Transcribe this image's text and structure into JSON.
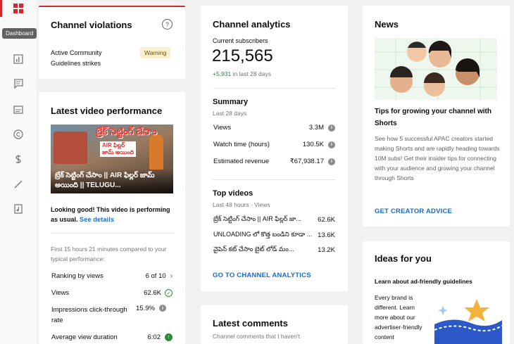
{
  "colors": {
    "accent": "#d0282b",
    "link": "#1a6cc7",
    "positive": "#2e8b3b",
    "warning_bg": "#fcefcf"
  },
  "nav": {
    "tooltip": "Dashboard"
  },
  "violations": {
    "title": "Channel violations",
    "label": "Active Community Guidelines strikes",
    "badge": "Warning"
  },
  "latest_video": {
    "title": "Latest video performance",
    "thumb_overlay_top": "బ్రేక్ సెట్టింగ్ చేసాం",
    "thumb_overlay_mid": "AIR ఫిల్లర్\nజామ్ అయింది",
    "thumb_caption": "బ్రేక్ సెట్టింగ్ చేసాం || AIR ఫిల్లర్ జామ్ అయింది || TELUGU...",
    "status_text": "Looking good! This video is performing as usual.",
    "status_link": "See details",
    "compare_text": "First 15 hours 21 minutes compared to your typical performance:",
    "metrics": [
      {
        "label": "Ranking by views",
        "value": "6 of 10"
      },
      {
        "label": "Views",
        "value": "62.6K"
      },
      {
        "label": "Impressions click-through rate",
        "value": "15.9%"
      },
      {
        "label": "Average view duration",
        "value": "6:02"
      }
    ]
  },
  "analytics": {
    "title": "Channel analytics",
    "subs_label": "Current subscribers",
    "subs_value": "215,565",
    "subs_delta": "+5,931",
    "subs_delta_suffix": " in last 28 days",
    "summary_title": "Summary",
    "summary_period": "Last 28 days",
    "summary": [
      {
        "label": "Views",
        "value": "3.3M"
      },
      {
        "label": "Watch time (hours)",
        "value": "130.5K"
      },
      {
        "label": "Estimated revenue",
        "value": "₹67,938.17"
      }
    ],
    "top_title": "Top videos",
    "top_period": "Last 48 hours · Views",
    "top_videos": [
      {
        "title": "బ్రేక్ సెట్టింగ్ చేసాం || AIR ఫిల్లర్ జా...",
        "views": "62.6K"
      },
      {
        "title": "UNLOADING లో కొత్త బండిని కూడా ...",
        "views": "13.6K"
      },
      {
        "title": "వైపెన్ కట్ చేసాం బైట్ లోడ్ మం...",
        "views": "13.2K"
      }
    ],
    "cta": "GO TO CHANNEL ANALYTICS"
  },
  "comments": {
    "title": "Latest comments",
    "subtitle": "Channel comments that I haven't"
  },
  "news": {
    "title": "News",
    "headline": "Tips for growing your channel with Shorts",
    "body": "See how 5 successful APAC creators started making Shorts and are rapidly heading towards 10M subs! Get their insider tips for connecting with your audience and growing your channel through Shorts",
    "cta": "GET CREATOR ADVICE"
  },
  "ideas": {
    "title": "Ideas for you",
    "subtitle": "Learn about ad-friendly guidelines",
    "body": "Every brand is different. Learn more about our advertiser-friendly content"
  }
}
